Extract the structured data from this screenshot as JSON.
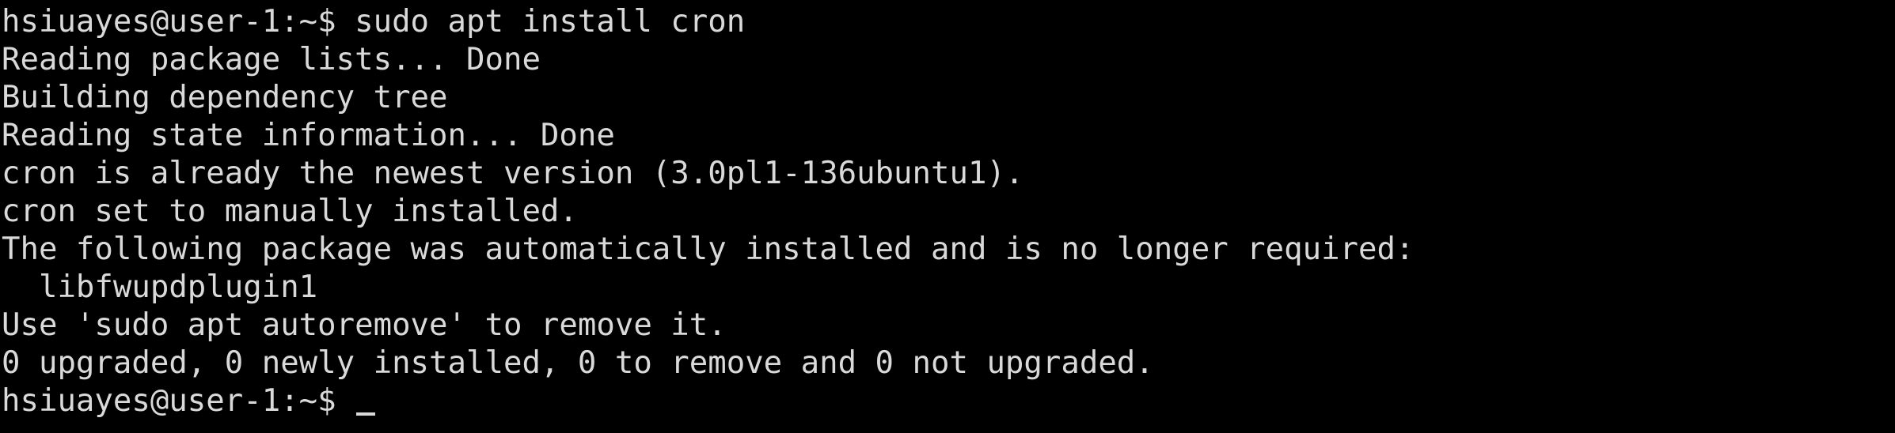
{
  "terminal": {
    "lines": [
      "hsiuayes@user-1:~$ sudo apt install cron",
      "Reading package lists... Done",
      "Building dependency tree",
      "Reading state information... Done",
      "cron is already the newest version (3.0pl1-136ubuntu1).",
      "cron set to manually installed.",
      "The following package was automatically installed and is no longer required:",
      "  libfwupdplugin1",
      "Use 'sudo apt autoremove' to remove it.",
      "0 upgraded, 0 newly installed, 0 to remove and 0 not upgraded."
    ],
    "prompt": "hsiuayes@user-1:~$ ",
    "text_color": "#d9d9d9",
    "background_color": "#000000"
  }
}
